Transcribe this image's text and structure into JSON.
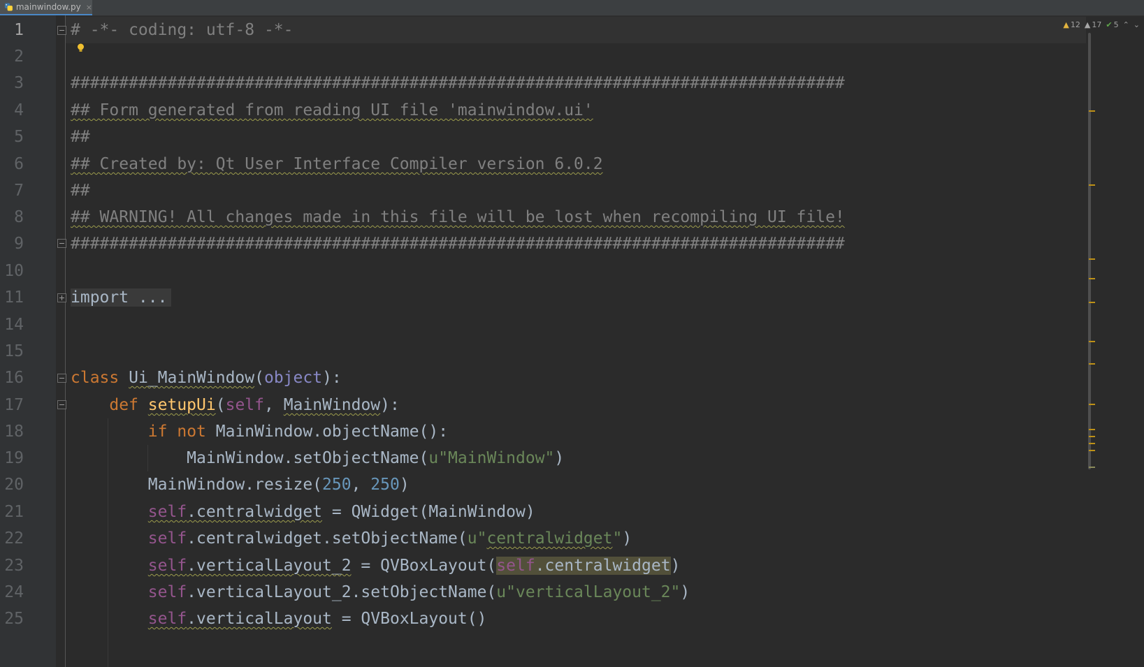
{
  "tab": {
    "file_name": "mainwindow.py",
    "close_glyph": "×",
    "icon": "python-file-icon"
  },
  "inspections": {
    "warnings_count": "12",
    "weak_warnings_count": "17",
    "typos_count": "5"
  },
  "colors": {
    "background": "#2b2b2b",
    "keyword": "#cc7832",
    "string": "#6a8759",
    "comment": "#808080",
    "self": "#94558d",
    "number": "#6897bb",
    "function": "#ffc66d"
  },
  "editor": {
    "line_numbers": [
      "1",
      "2",
      "3",
      "4",
      "5",
      "6",
      "7",
      "8",
      "9",
      "10",
      "11",
      "14",
      "15",
      "16",
      "17",
      "18",
      "19",
      "20",
      "21",
      "22",
      "23",
      "24",
      "25"
    ],
    "lines": {
      "l1": "# -*- coding: utf-8 -*-",
      "l3": "################################################################################",
      "l4": "## Form generated from reading UI file 'mainwindow.ui'",
      "l5": "##",
      "l6": "## Created by: Qt User Interface Compiler version 6.0.2",
      "l7": "##",
      "l8": "## WARNING! All changes made in this file will be lost when recompiling UI file!",
      "l9": "################################################################################",
      "l11_folded": "import ...",
      "l16": {
        "kw": "class",
        "name": "Ui_MainWindow",
        "open": "(",
        "base": "object",
        "close": "):"
      },
      "l17": {
        "kw": "def",
        "name": "setupUi",
        "open": "(",
        "self": "self",
        "sep": ", ",
        "param": "MainWindow",
        "close": "):"
      },
      "l18": {
        "kw1": "if",
        "kw2": "not",
        "rest": "MainWindow.objectName():"
      },
      "l19": {
        "pre": "MainWindow.setObjectName(",
        "str": "u\"MainWindow\"",
        "post": ")"
      },
      "l20": {
        "pre": "MainWindow.resize(",
        "n1": "250",
        "sep": ", ",
        "n2": "250",
        "post": ")"
      },
      "l21": {
        "self": "self",
        "attr": ".centralwidget",
        "rest": " = QWidget(MainWindow)"
      },
      "l22": {
        "self": "self",
        "pre": ".centralwidget.setObjectName(",
        "u": "u\"",
        "strw": "centralwidget",
        "q": "\"",
        "post": ")"
      },
      "l23": {
        "self": "self",
        "attr": ".verticalLayout_2",
        "mid": " = QVBoxLayout(",
        "self2": "self",
        "arg": ".centralwidget",
        "post": ")"
      },
      "l24": {
        "self": "self",
        "pre": ".verticalLayout_2.setObjectName(",
        "str": "u\"verticalLayout_2\"",
        "post": ")"
      },
      "l25": {
        "self": "self",
        "attr": ".verticalLayout",
        "rest": " = QVBoxLayout()"
      }
    }
  }
}
